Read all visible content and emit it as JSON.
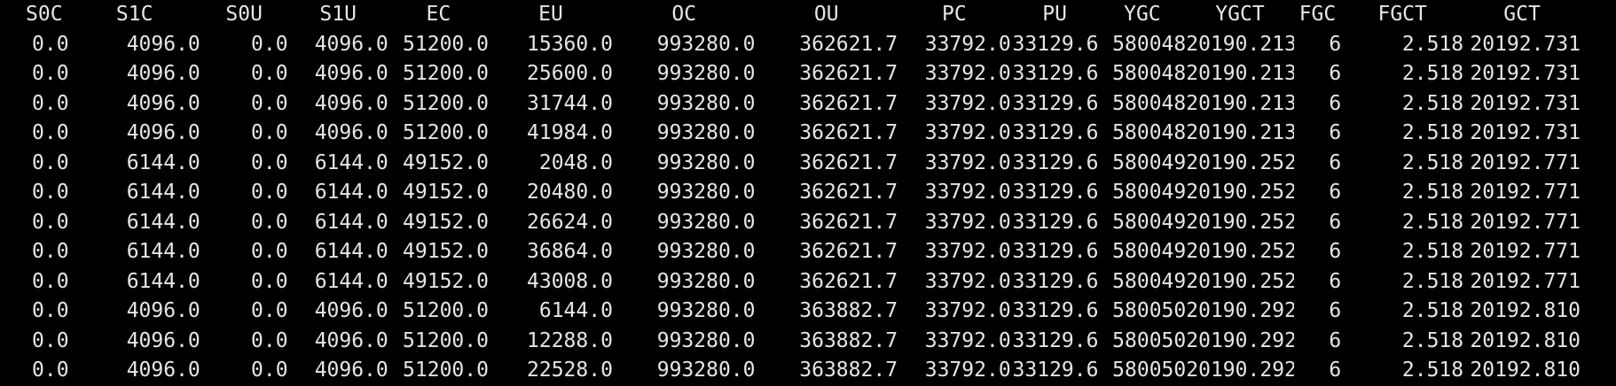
{
  "columns": [
    "S0C",
    "S1C",
    "S0U",
    "S1U",
    "EC",
    "EU",
    "OC",
    "OU",
    "PC",
    "PU",
    "YGC",
    "YGCT",
    "FGC",
    "FGCT",
    "GCT"
  ],
  "rows": [
    [
      "0.0",
      "4096.0",
      "0.0",
      "4096.0",
      "51200.0",
      "15360.0",
      "993280.0",
      "362621.7",
      "33792.0",
      "33129.6",
      "580048",
      "20190.213",
      "6",
      "2.518",
      "20192.731"
    ],
    [
      "0.0",
      "4096.0",
      "0.0",
      "4096.0",
      "51200.0",
      "25600.0",
      "993280.0",
      "362621.7",
      "33792.0",
      "33129.6",
      "580048",
      "20190.213",
      "6",
      "2.518",
      "20192.731"
    ],
    [
      "0.0",
      "4096.0",
      "0.0",
      "4096.0",
      "51200.0",
      "31744.0",
      "993280.0",
      "362621.7",
      "33792.0",
      "33129.6",
      "580048",
      "20190.213",
      "6",
      "2.518",
      "20192.731"
    ],
    [
      "0.0",
      "4096.0",
      "0.0",
      "4096.0",
      "51200.0",
      "41984.0",
      "993280.0",
      "362621.7",
      "33792.0",
      "33129.6",
      "580048",
      "20190.213",
      "6",
      "2.518",
      "20192.731"
    ],
    [
      "0.0",
      "6144.0",
      "0.0",
      "6144.0",
      "49152.0",
      "2048.0",
      "993280.0",
      "362621.7",
      "33792.0",
      "33129.6",
      "580049",
      "20190.252",
      "6",
      "2.518",
      "20192.771"
    ],
    [
      "0.0",
      "6144.0",
      "0.0",
      "6144.0",
      "49152.0",
      "20480.0",
      "993280.0",
      "362621.7",
      "33792.0",
      "33129.6",
      "580049",
      "20190.252",
      "6",
      "2.518",
      "20192.771"
    ],
    [
      "0.0",
      "6144.0",
      "0.0",
      "6144.0",
      "49152.0",
      "26624.0",
      "993280.0",
      "362621.7",
      "33792.0",
      "33129.6",
      "580049",
      "20190.252",
      "6",
      "2.518",
      "20192.771"
    ],
    [
      "0.0",
      "6144.0",
      "0.0",
      "6144.0",
      "49152.0",
      "36864.0",
      "993280.0",
      "362621.7",
      "33792.0",
      "33129.6",
      "580049",
      "20190.252",
      "6",
      "2.518",
      "20192.771"
    ],
    [
      "0.0",
      "6144.0",
      "0.0",
      "6144.0",
      "49152.0",
      "43008.0",
      "993280.0",
      "362621.7",
      "33792.0",
      "33129.6",
      "580049",
      "20190.252",
      "6",
      "2.518",
      "20192.771"
    ],
    [
      "0.0",
      "4096.0",
      "0.0",
      "4096.0",
      "51200.0",
      "6144.0",
      "993280.0",
      "363882.7",
      "33792.0",
      "33129.6",
      "580050",
      "20190.292",
      "6",
      "2.518",
      "20192.810"
    ],
    [
      "0.0",
      "4096.0",
      "0.0",
      "4096.0",
      "51200.0",
      "12288.0",
      "993280.0",
      "363882.7",
      "33792.0",
      "33129.6",
      "580050",
      "20190.292",
      "6",
      "2.518",
      "20192.810"
    ],
    [
      "0.0",
      "4096.0",
      "0.0",
      "4096.0",
      "51200.0",
      "22528.0",
      "993280.0",
      "363882.7",
      "33792.0",
      "33129.6",
      "580050",
      "20190.292",
      "6",
      "2.518",
      "20192.810"
    ]
  ],
  "colors": {
    "background": "#000000",
    "text": "#e6e6e6"
  }
}
